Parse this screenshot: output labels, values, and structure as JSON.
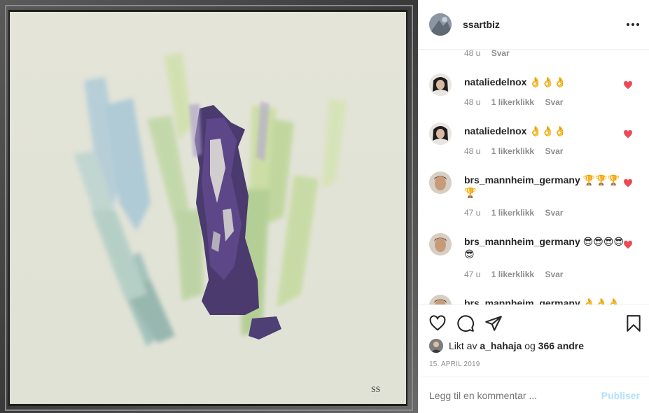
{
  "post": {
    "username": "ssartbiz",
    "more_icon": "more-icon",
    "painting_signature": "SS"
  },
  "comments": [
    {
      "user": "",
      "text": "",
      "time": "48 u",
      "likes": "",
      "reply": "Svar",
      "liked": false
    },
    {
      "user": "nataliedelnox",
      "text": "👌👌👌",
      "time": "48 u",
      "likes": "1 likerklikk",
      "reply": "Svar",
      "liked": true
    },
    {
      "user": "nataliedelnox",
      "text": "👌👌👌",
      "time": "48 u",
      "likes": "1 likerklikk",
      "reply": "Svar",
      "liked": true
    },
    {
      "user": "brs_mannheim_germany",
      "text": "🏆🏆🏆🏆",
      "time": "47 u",
      "likes": "1 likerklikk",
      "reply": "Svar",
      "liked": true
    },
    {
      "user": "brs_mannheim_germany",
      "text": "😎😎😎😎😎",
      "time": "47 u",
      "likes": "1 likerklikk",
      "reply": "Svar",
      "liked": true
    },
    {
      "user": "brs_mannheim_germany",
      "text": "👌👌👌",
      "time": "",
      "likes": "",
      "reply": "",
      "liked": false
    }
  ],
  "actions": {
    "like_icon": "heart-icon",
    "comment_icon": "comment-icon",
    "share_icon": "share-icon",
    "save_icon": "bookmark-icon"
  },
  "liked_by": {
    "prefix": "Likt av",
    "user": "a_hahaja",
    "joiner": "og",
    "others": "366 andre"
  },
  "date": "15. APRIL 2019",
  "add_comment": {
    "placeholder": "Legg til en kommentar ...",
    "post_label": "Publiser"
  },
  "colors": {
    "heart_red": "#ed4956",
    "publish_disabled": "#b2dffc",
    "meta_gray": "#8e8e8e"
  }
}
